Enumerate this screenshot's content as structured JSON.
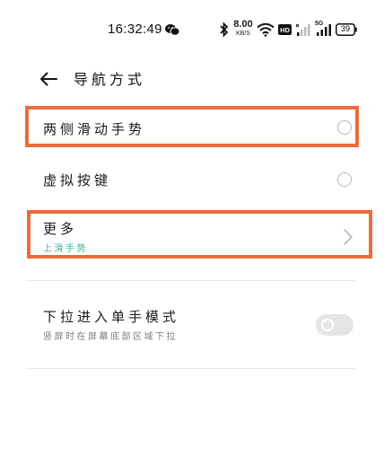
{
  "status_bar": {
    "time": "16:32:49",
    "net_speed_value": "8.00",
    "net_speed_unit": "KB/S",
    "hd_label": "HD",
    "signal2_label": "5G",
    "battery_level": "39"
  },
  "header": {
    "title": "导航方式"
  },
  "options": [
    {
      "label": "两侧滑动手势",
      "selected": false
    },
    {
      "label": "虚拟按键",
      "selected": false
    },
    {
      "label": "更多",
      "sublabel": "上滑手势"
    }
  ],
  "one_hand_mode": {
    "label": "下拉进入单手模式",
    "sublabel": "竖屏时在屏幕底部区域下拉",
    "enabled": false
  },
  "colors": {
    "highlight_border": "#ec6c3c",
    "sublabel_teal": "#36b6a0"
  }
}
